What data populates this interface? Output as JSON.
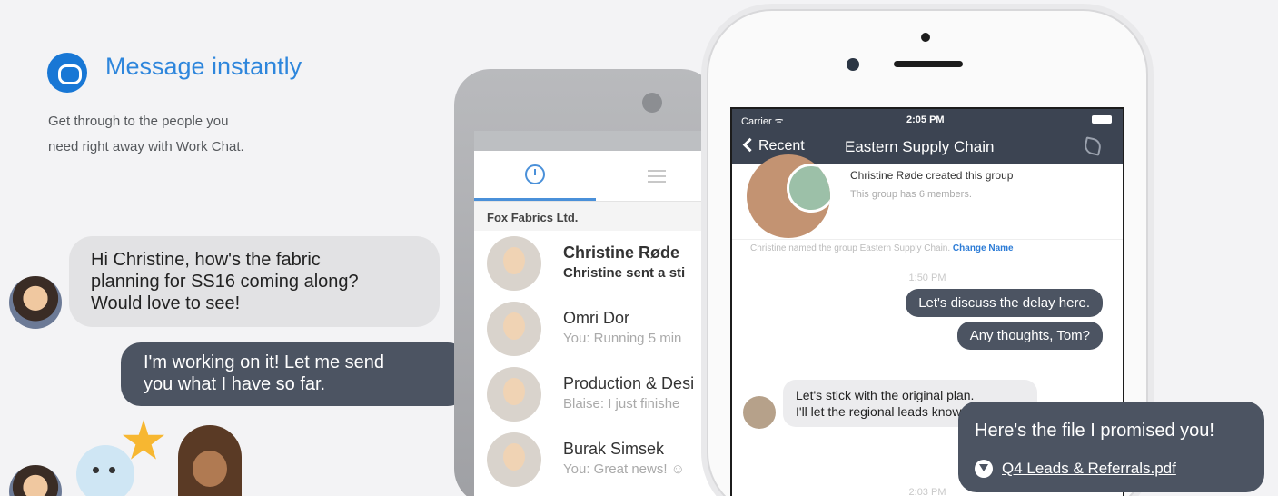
{
  "hero": {
    "title": "Message instantly",
    "subtitle_line1": "Get through to the people you",
    "subtitle_line2": "need right away with Work Chat."
  },
  "bubbles": {
    "left": [
      "Hi Christine, how's the fabric",
      "planning for SS16 coming along?",
      "Would love to see!"
    ],
    "right": [
      "I'm working on it! Let me send",
      "you what I have so far."
    ]
  },
  "android": {
    "group_label": "Fox Fabrics Ltd.",
    "conversations": [
      {
        "name": "Christine Røde",
        "preview": "Christine sent a sti",
        "unread": true
      },
      {
        "name": "Omri Dor",
        "preview": "You: Running 5 min",
        "unread": false
      },
      {
        "name": "Production & Desi",
        "preview": "Blaise: I just finishe",
        "unread": false
      },
      {
        "name": "Burak Simsek",
        "preview": "You: Great news! ☺",
        "unread": false
      }
    ]
  },
  "iphone": {
    "status": {
      "carrier": "Carrier ᯤ",
      "time": "2:05 PM"
    },
    "nav": {
      "back_label": "Recent",
      "title": "Eastern Supply Chain"
    },
    "group_created": "Christine Røde created this group",
    "group_members": "This group has 6 members.",
    "system_message": "Christine named the group Eastern Supply Chain.",
    "change_name_link": "Change Name",
    "time_1": "1:50 PM",
    "outgoing": [
      "Let's discuss the delay here.",
      "Any thoughts, Tom?"
    ],
    "incoming": [
      "Let's stick with the original plan.",
      "I'll let the regional leads know."
    ],
    "time_2": "2:03 PM"
  },
  "file_callout": {
    "text": "Here's the file I promised you!",
    "link": "Q4 Leads & Referrals.pdf"
  },
  "colors": {
    "accent": "#2e86dc",
    "dark_bubble": "#4c5462",
    "light_bubble": "#e2e2e4"
  }
}
